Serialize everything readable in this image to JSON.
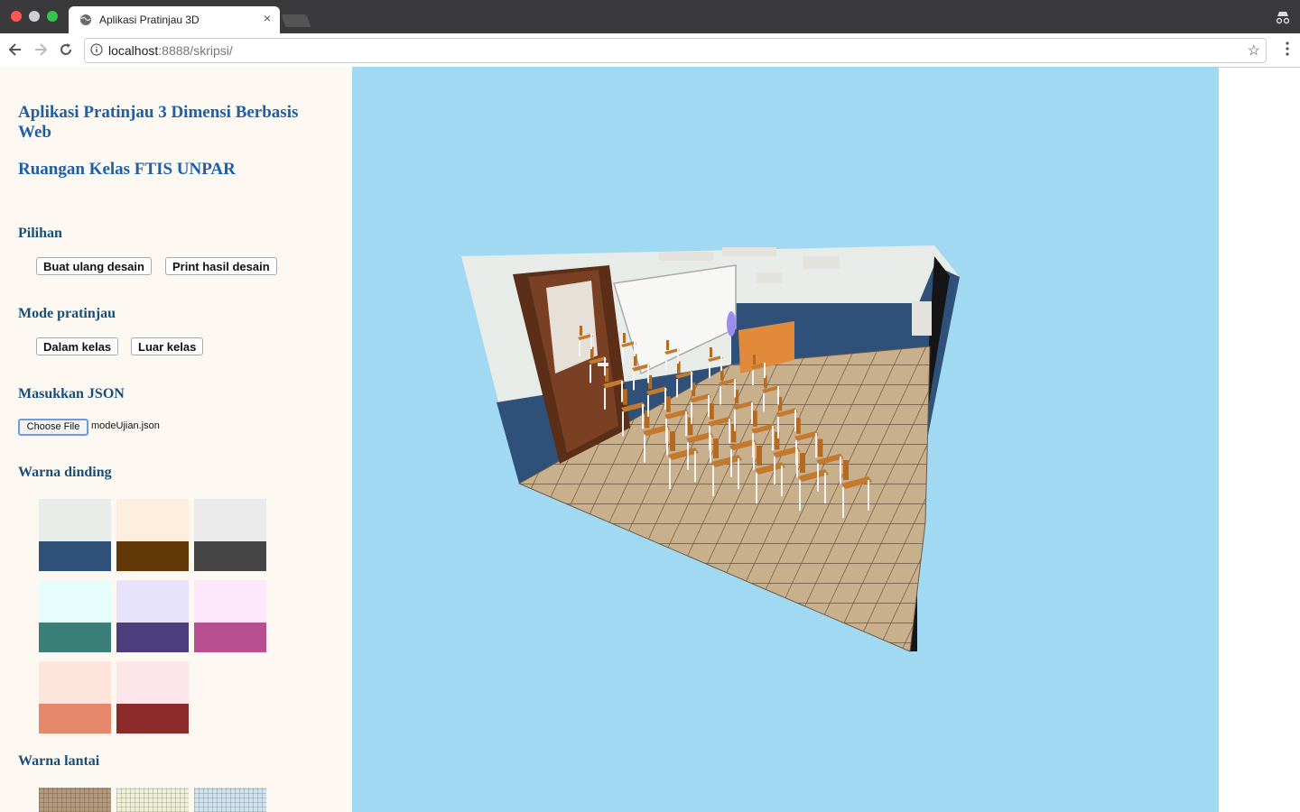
{
  "browser": {
    "tab_title": "Aplikasi Pratinjau 3D",
    "tab_close": "×",
    "url_host": "localhost",
    "url_rest": ":8888/skripsi/",
    "star_glyph": "☆"
  },
  "sidebar": {
    "app_title": "Aplikasi Pratinjau 3 Dimensi Berbasis Web",
    "room_title": "Ruangan Kelas FTIS UNPAR",
    "options_heading": "Pilihan",
    "options_buttons": [
      "Buat ulang desain",
      "Print hasil desain"
    ],
    "mode_heading": "Mode pratinjau",
    "mode_buttons": [
      "Dalam kelas",
      "Luar kelas"
    ],
    "json_heading": "Masukkan JSON",
    "file_button": "Choose File",
    "file_name": "modeUjian.json",
    "wall_heading": "Warna dinding",
    "wall_colors": [
      {
        "top": "#e8ede9",
        "bottom": "#2f5078"
      },
      {
        "top": "#fdeedd",
        "bottom": "#633808"
      },
      {
        "top": "#ebebeb",
        "bottom": "#454546"
      },
      {
        "top": "#e5fefb",
        "bottom": "#3b7f78"
      },
      {
        "top": "#e8e3fd",
        "bottom": "#4c3d7d"
      },
      {
        "top": "#fde8fb",
        "bottom": "#b75090"
      },
      {
        "top": "#fde5db",
        "bottom": "#e6886b"
      },
      {
        "top": "#fde6e9",
        "bottom": "#8c2b2b"
      }
    ],
    "floor_heading": "Warna lantai",
    "floor_colors": [
      "#b39a7c",
      "#eef0d6",
      "#cfe3ee"
    ]
  },
  "viewport": {
    "background": "#a1d9f2"
  }
}
